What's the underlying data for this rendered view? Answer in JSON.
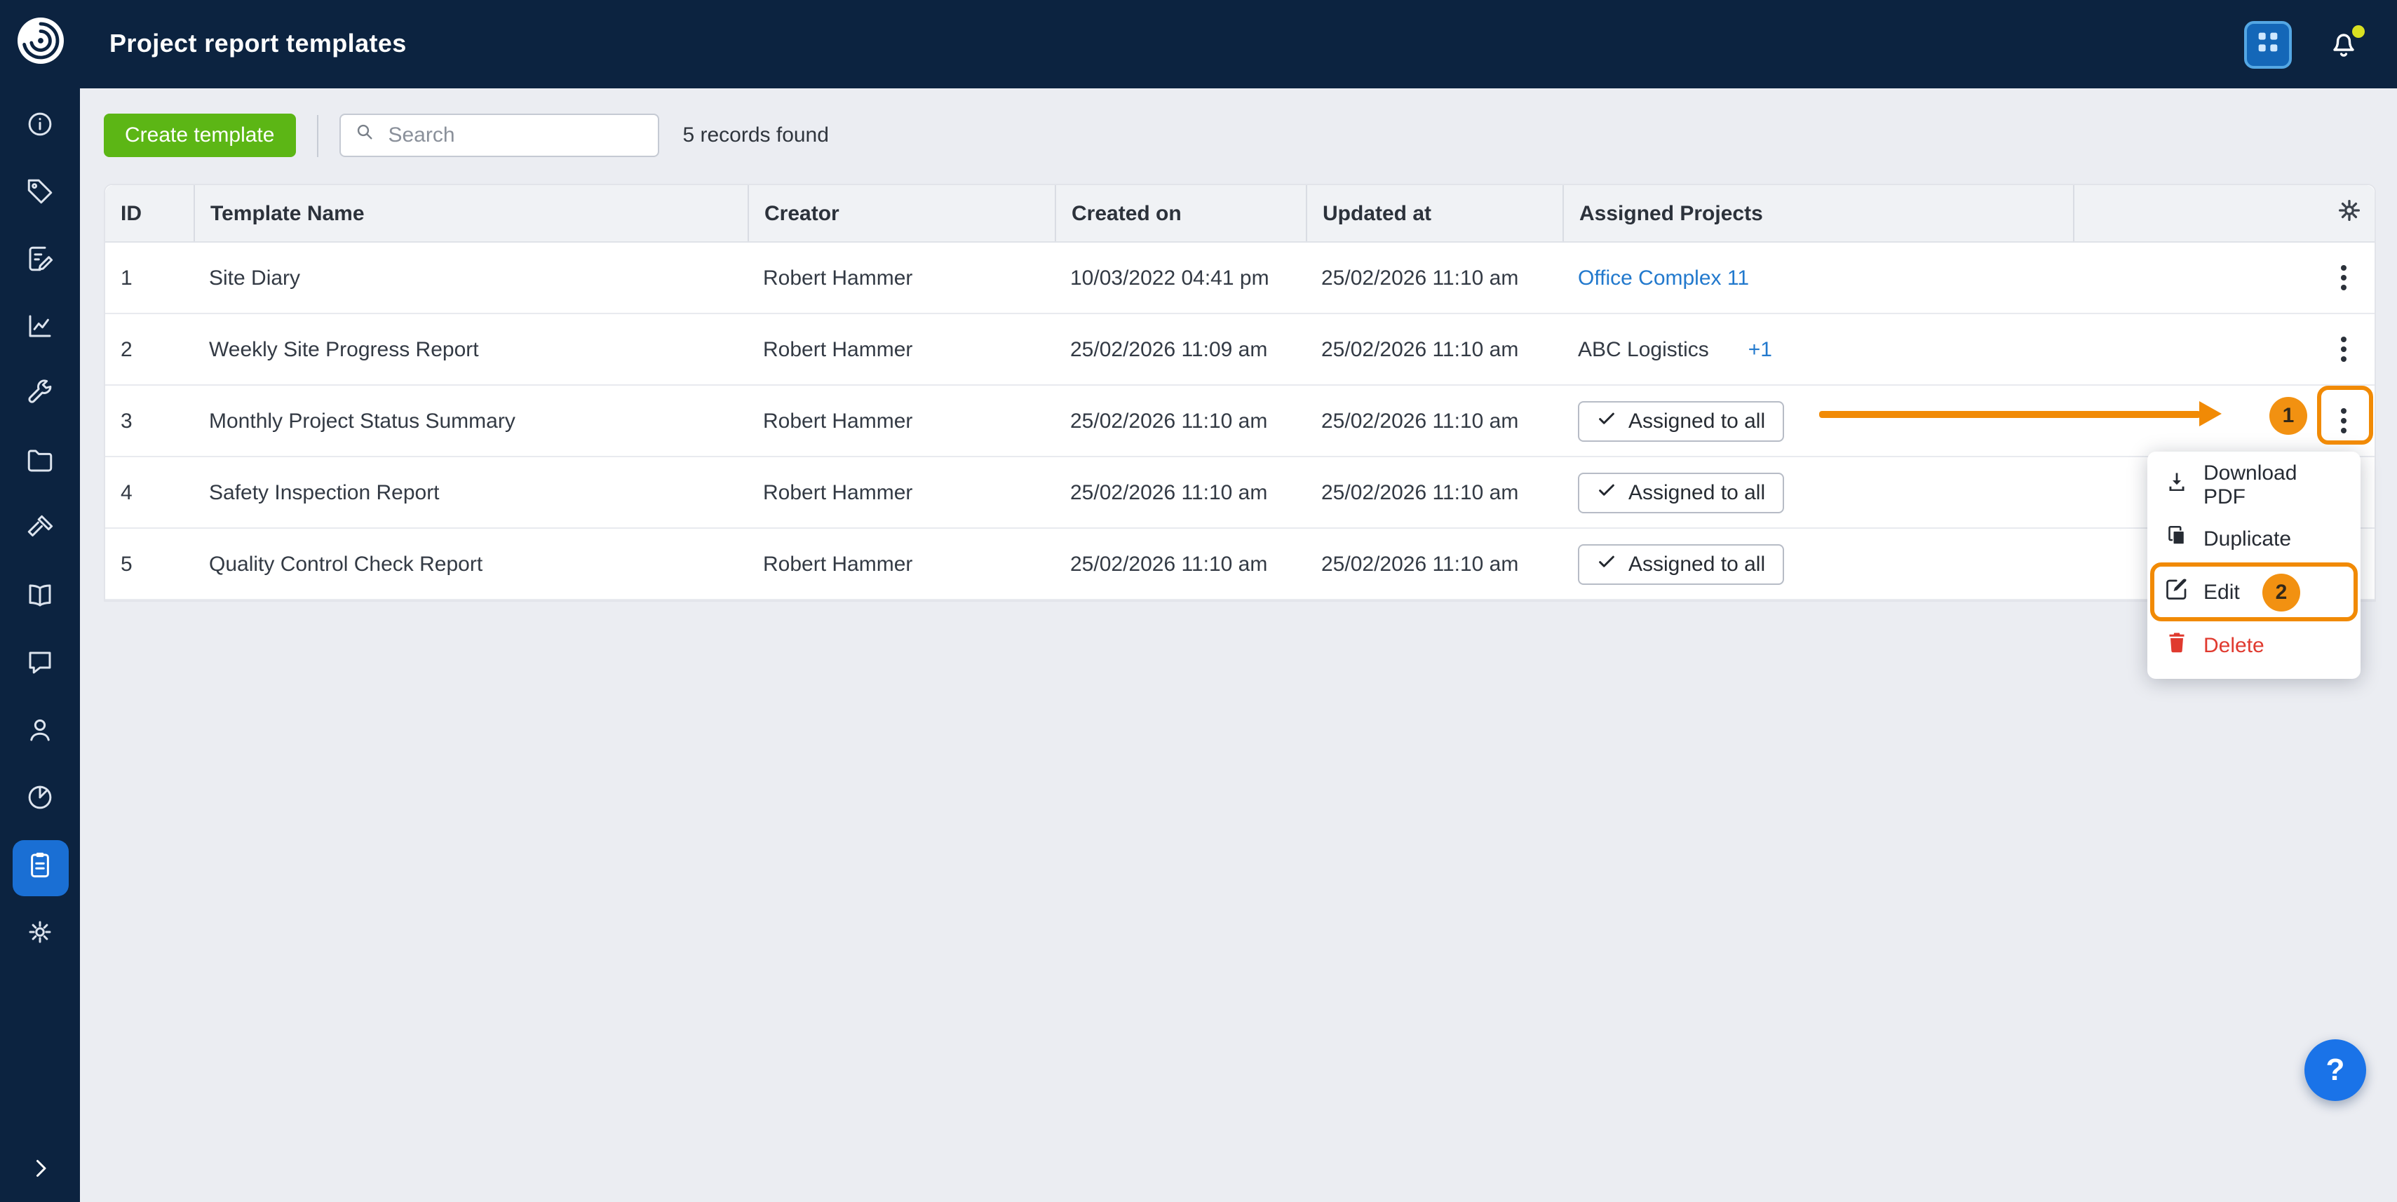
{
  "header": {
    "title": "Project report templates"
  },
  "topbar": {
    "icons": [
      "apps-grid",
      "notifications-bell"
    ]
  },
  "sidebar": {
    "items": [
      "dashboard",
      "tags",
      "tasks",
      "reports-chart",
      "tools",
      "projects-folder",
      "site-works",
      "library-book",
      "messages",
      "contacts",
      "analytics-pie",
      "report-templates",
      "settings"
    ],
    "active_item": "report-templates",
    "expand_label": "chevron-right"
  },
  "toolbar": {
    "create_button": "Create template",
    "search_placeholder": "Search",
    "records_found": "5 records found"
  },
  "table": {
    "columns": [
      "ID",
      "Template Name",
      "Creator",
      "Created on",
      "Updated at",
      "Assigned Projects"
    ],
    "rows": [
      {
        "id": "1",
        "name": "Site Diary",
        "creator": "Robert Hammer",
        "created_on": "10/03/2022 04:41 pm",
        "updated_at": "25/02/2026 11:10 am",
        "assigned": {
          "type": "link",
          "label": "Office Complex 11"
        }
      },
      {
        "id": "2",
        "name": "Weekly Site Progress Report",
        "creator": "Robert Hammer",
        "created_on": "25/02/2026 11:09 am",
        "updated_at": "25/02/2026 11:10 am",
        "assigned": {
          "type": "text_plus",
          "label": "ABC Logistics",
          "extra": "+1"
        }
      },
      {
        "id": "3",
        "name": "Monthly Project Status Summary",
        "creator": "Robert Hammer",
        "created_on": "25/02/2026 11:10 am",
        "updated_at": "25/02/2026 11:10 am",
        "assigned": {
          "type": "all",
          "label": "Assigned to all"
        }
      },
      {
        "id": "4",
        "name": "Safety Inspection Report",
        "creator": "Robert Hammer",
        "created_on": "25/02/2026 11:10 am",
        "updated_at": "25/02/2026 11:10 am",
        "assigned": {
          "type": "all",
          "label": "Assigned to all"
        }
      },
      {
        "id": "5",
        "name": "Quality Control Check Report",
        "creator": "Robert Hammer",
        "created_on": "25/02/2026 11:10 am",
        "updated_at": "25/02/2026 11:10 am",
        "assigned": {
          "type": "all",
          "label": "Assigned to all"
        }
      }
    ]
  },
  "context_menu": {
    "items": [
      {
        "label": "Download PDF",
        "icon": "download-icon"
      },
      {
        "label": "Duplicate",
        "icon": "duplicate-icon"
      },
      {
        "label": "Edit",
        "icon": "edit-icon",
        "highlighted": true
      },
      {
        "label": "Delete",
        "icon": "trash-icon",
        "danger": true
      }
    ]
  },
  "annotations": {
    "step1": "1",
    "step2": "2"
  },
  "help": {
    "label": "?"
  },
  "colors": {
    "navy": "#0c2340",
    "active_blue": "#1a6fd4",
    "green_button": "#5cb615",
    "link_blue": "#2279cd",
    "annotation_orange": "#f18a05",
    "danger_red": "#e03a2f",
    "help_blue": "#1a73e8",
    "notification_dot": "#d9e021"
  }
}
